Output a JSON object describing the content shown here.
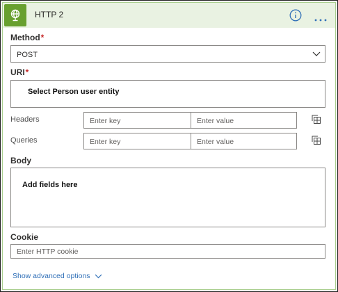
{
  "card": {
    "title": "HTTP 2",
    "icons": {
      "connector": "globe-icon",
      "info": "info-icon",
      "more": "more-options-icon"
    }
  },
  "method": {
    "label": "Method",
    "required_mark": "*",
    "value": "POST"
  },
  "uri": {
    "label": "URI",
    "required_mark": "*",
    "value": "Select Person user entity"
  },
  "headers": {
    "label": "Headers",
    "key_placeholder": "Enter key",
    "value_placeholder": "Enter value"
  },
  "queries": {
    "label": "Queries",
    "key_placeholder": "Enter key",
    "value_placeholder": "Enter value"
  },
  "body": {
    "label": "Body",
    "value": "Add fields here"
  },
  "cookie": {
    "label": "Cookie",
    "placeholder": "Enter HTTP cookie"
  },
  "advanced": {
    "label": "Show advanced options"
  },
  "colors": {
    "header_bg": "#e9f2e2",
    "icon_bg": "#68a02f",
    "card_border": "#a9cf8f",
    "link": "#2f6fb7",
    "required": "#c62828"
  }
}
